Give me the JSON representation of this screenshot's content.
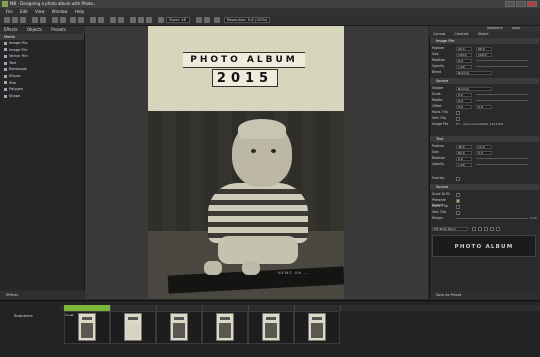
{
  "app": {
    "title": "MB - Designing a photo album with Photo..."
  },
  "menu": [
    "File",
    "Edit",
    "View",
    "Window",
    "Help"
  ],
  "toolbar": {
    "zoom_value": "Zoom: 48",
    "resolution_value": "Resolution: Full (100%)"
  },
  "left_panel": {
    "tabs": [
      "Effects",
      "Objects",
      "Presets"
    ],
    "header": "Media",
    "items": [
      "Image File",
      "Image File",
      "Vector File",
      "Text",
      "Rectangle",
      "Ellipse",
      "Star",
      "Polygon",
      "Shape"
    ],
    "footer": "Effects"
  },
  "page": {
    "title": "PHOTO ALBUM",
    "year": "2015",
    "photo_caption": "NEWS ON ..."
  },
  "right_panel": {
    "top_tabs": [
      "Sequence",
      "Layer"
    ],
    "tabs": [
      "Canvas",
      "Controls",
      "Object"
    ],
    "image_section": "Image File",
    "image_rows": [
      {
        "label": "Position",
        "v1": "92.0",
        "v2": "66.0"
      },
      {
        "label": "Size",
        "v1": "100.0",
        "v2": "100.0"
      },
      {
        "label": "Rotation",
        "v1": "0.0"
      },
      {
        "label": "Opacity",
        "v1": "1.00"
      },
      {
        "label": "Blend",
        "v1": "Normal"
      }
    ],
    "source_section": "Source",
    "source_rows": [
      {
        "label": "Shader",
        "v1": "Normal"
      },
      {
        "label": "Scale",
        "v1": "0.0"
      },
      {
        "label": "Rotate",
        "v1": "0.0"
      },
      {
        "label": "Offset",
        "v1": "0.0",
        "v2": "0.0"
      },
      {
        "label": "Horiz. Flip"
      },
      {
        "label": "Vert. Flip"
      },
      {
        "label": "Image File",
        "v1": "D:\\...\\Documents\\IMG_2123.JPG"
      }
    ],
    "text_section": "Text",
    "text_rows": [
      {
        "label": "Position",
        "v1": "46.6",
        "v2": "12.0"
      },
      {
        "label": "Size",
        "v1": "82.0",
        "v2": "0.0"
      },
      {
        "label": "Rotation",
        "v1": "0.0"
      },
      {
        "label": "Opacity",
        "v1": "1.00"
      }
    ],
    "overlay_label": "Overlay",
    "text_source_section": "Source",
    "text_source_rows": [
      {
        "label": "Scale To Fit"
      },
      {
        "label": "Preserve Aspect"
      },
      {
        "label": "Horiz. Flip"
      },
      {
        "label": "Vert. Flip"
      },
      {
        "label": "Margin",
        "v1": "0.00"
      }
    ],
    "font_label": "MS Shell Dlg 2",
    "preview_text": "PHOTO ALBUM",
    "footer": "Save As Preset"
  },
  "timeline": {
    "sequence_label": "Sequence",
    "clip_name": "Cover"
  }
}
